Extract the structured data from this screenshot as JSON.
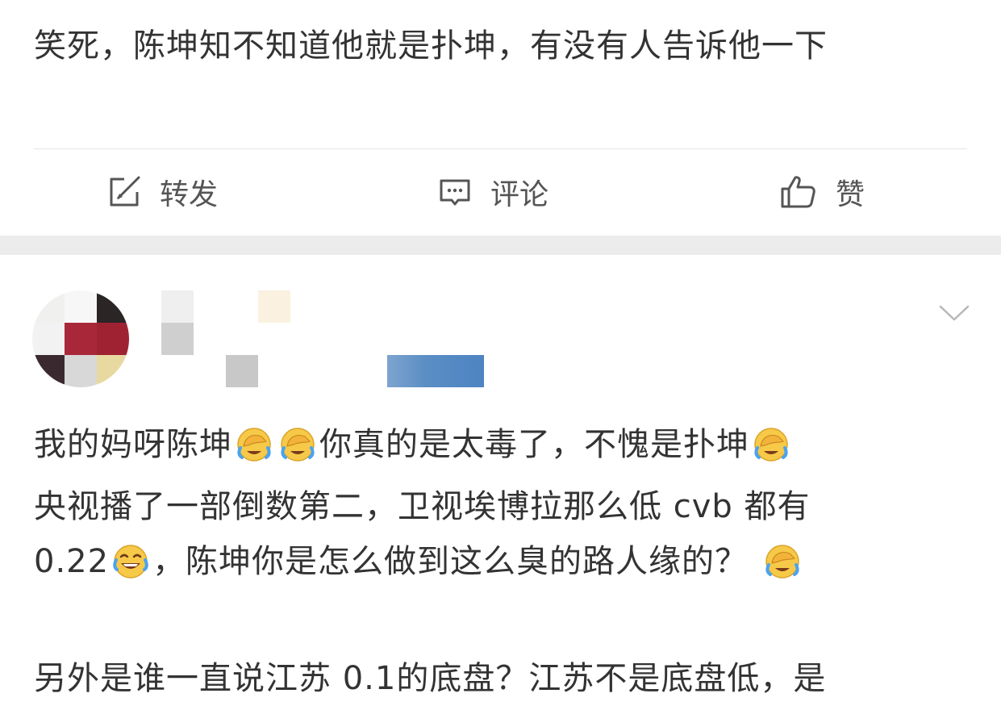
{
  "post": {
    "text": "笑死，陈坤知不知道他就是扑坤，有没有人告诉他一下"
  },
  "actions": {
    "repost_label": "转发",
    "comment_label": "评论",
    "like_label": "赞"
  },
  "comment": {
    "line1_a": "我的妈呀陈坤",
    "line1_b": "你真的是太毒了，不愧是扑坤",
    "line2": "央视播了一部倒数第二，卫视埃博拉那么低 cvb 都有",
    "line3_a": "0.22",
    "line3_b": "，陈坤你是怎么做到这么臭的路人缘的？",
    "line4": "另外是谁一直说江苏 0.1的底盘？江苏不是底盘低，是"
  },
  "colors": {
    "text": "#333333",
    "action_text": "#555555",
    "divider": "#e6e6e6",
    "section_gap": "#ececec",
    "emoji_yellow": "#f7c948",
    "tear_blue": "#4aa3f0",
    "name_blur_blue": "#5a8ec4"
  },
  "icons": {
    "repost": "repost-icon",
    "comment": "comment-icon",
    "like": "thumbs-up-icon",
    "more": "chevron-down-icon",
    "emoji_facepalm": "facepalm-crying-emoji",
    "emoji_laugh": "laugh-crying-emoji"
  }
}
